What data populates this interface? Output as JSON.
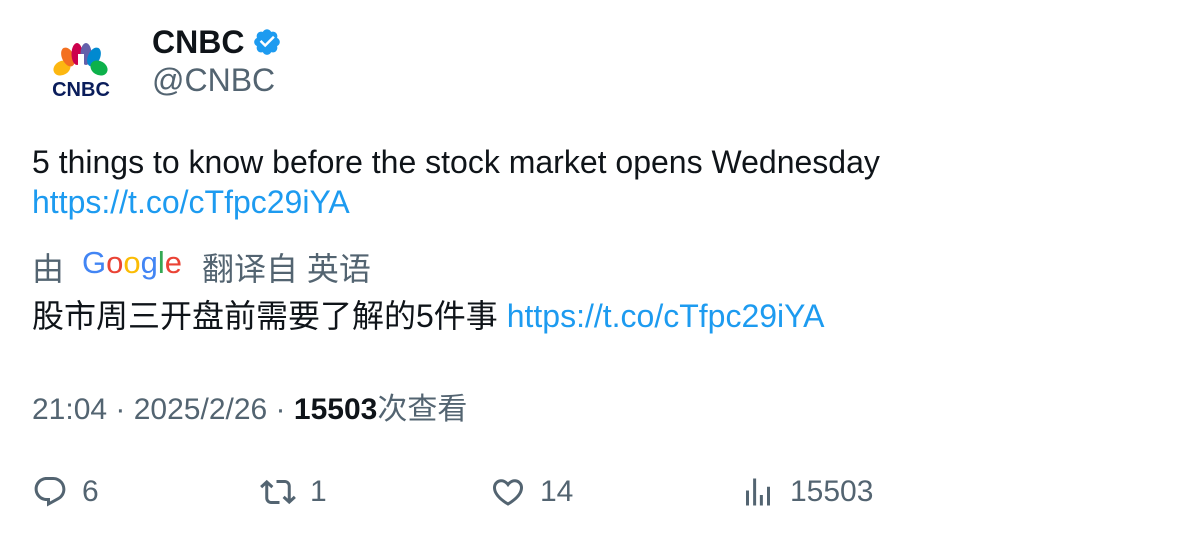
{
  "author": {
    "display_name": "CNBC",
    "handle": "@CNBC",
    "verified": true,
    "avatar_logo": "CNBC"
  },
  "tweet": {
    "text": "5 things to know before the stock market opens Wednesday",
    "link": "https://t.co/cTfpc29iYA"
  },
  "translation": {
    "prefix": "由",
    "provider": "Google",
    "suffix": "翻译自 英语",
    "text": "股市周三开盘前需要了解的5件事",
    "link": "https://t.co/cTfpc29iYA"
  },
  "meta": {
    "time": "21:04",
    "separator1": " · ",
    "date": "2025/2/26",
    "separator2": " · ",
    "views_count": "15503",
    "views_label": "次查看"
  },
  "actions": {
    "reply_count": "6",
    "retweet_count": "1",
    "like_count": "14",
    "views_count": "15503"
  },
  "colors": {
    "link": "#1d9bf0",
    "secondary_text": "#536471",
    "primary_text": "#0f1419",
    "verified": "#1d9bf0"
  },
  "icons": {
    "verified": "verified-badge-icon",
    "reply": "reply-icon",
    "retweet": "retweet-icon",
    "like": "heart-icon",
    "views": "views-bar-chart-icon"
  }
}
